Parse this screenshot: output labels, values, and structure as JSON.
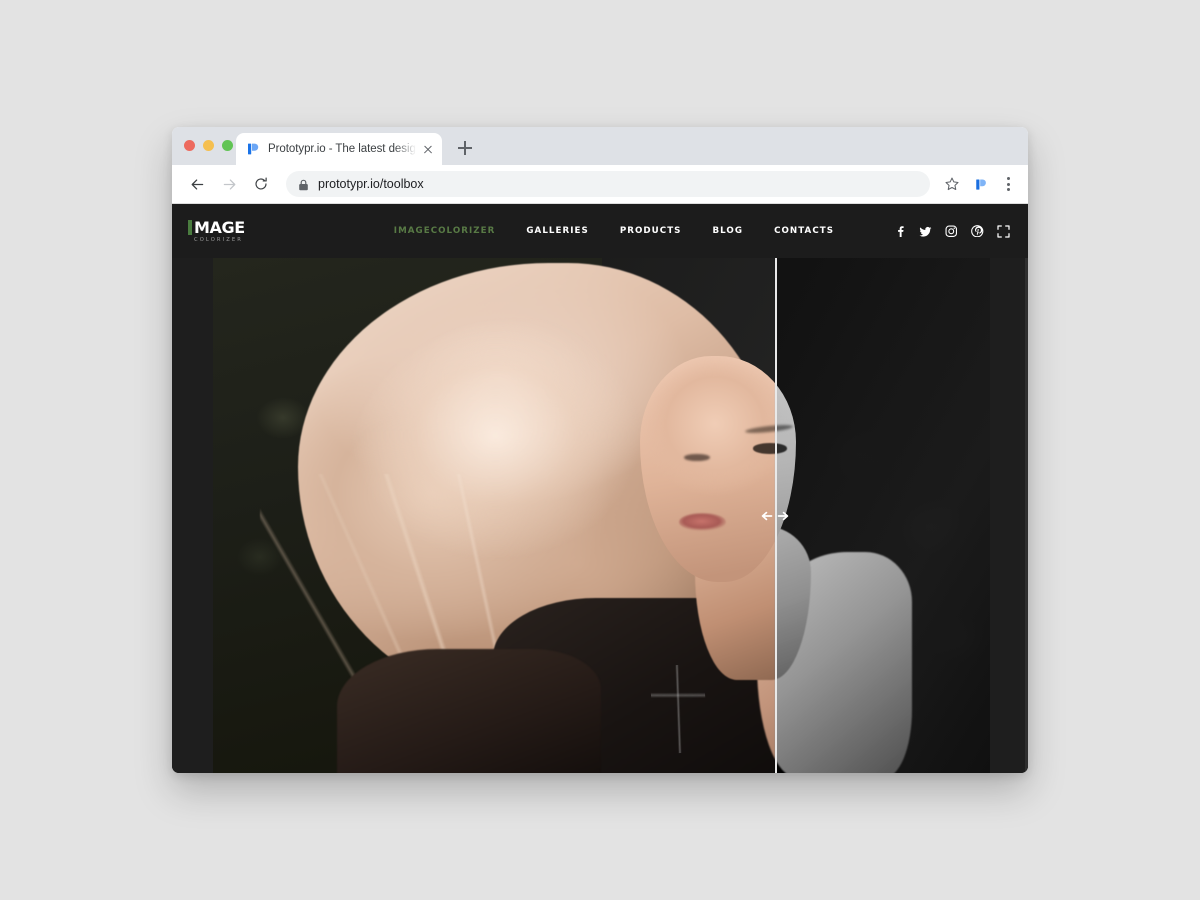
{
  "browser": {
    "window_controls": [
      {
        "name": "close",
        "color": "#ed6a5e"
      },
      {
        "name": "minimize",
        "color": "#f5bf4f"
      },
      {
        "name": "maximize",
        "color": "#61c454"
      }
    ],
    "tab": {
      "title": "Prototypr.io - The latest design an",
      "favicon": "prototypr-logo-icon",
      "close_label": "×"
    },
    "new_tab_label": "+",
    "toolbar": {
      "back_icon": "back-arrow-icon",
      "forward_icon": "forward-arrow-icon",
      "reload_icon": "reload-icon",
      "lock_icon": "lock-icon",
      "url": "prototypr.io/toolbox",
      "bookmark_icon": "star-icon",
      "extension_icon": "prototypr-extension-icon",
      "menu_icon": "kebab-menu-icon"
    }
  },
  "site": {
    "logo": {
      "word": "MAGE",
      "subtitle": "COLORIZER",
      "accent_color": "#4a7c3f"
    },
    "menu": [
      {
        "label": "IMAGECOLORIZER",
        "active": true
      },
      {
        "label": "GALLERIES",
        "active": false
      },
      {
        "label": "PRODUCTS",
        "active": false
      },
      {
        "label": "BLOG",
        "active": false
      },
      {
        "label": "CONTACTS",
        "active": false
      }
    ],
    "social": [
      {
        "name": "facebook-icon"
      },
      {
        "name": "twitter-icon"
      },
      {
        "name": "instagram-icon"
      },
      {
        "name": "pinterest-icon"
      },
      {
        "name": "fullscreen-icon"
      }
    ],
    "comparison": {
      "left_label": "colorized",
      "right_label": "black-and-white",
      "divider_position_percent": 72,
      "handle_icon": "left-right-drag-arrows-icon"
    },
    "background_color": "#1e1e1e",
    "nav_background_color": "#1c1c1c"
  },
  "page": {
    "background_color": "#e3e3e3"
  }
}
